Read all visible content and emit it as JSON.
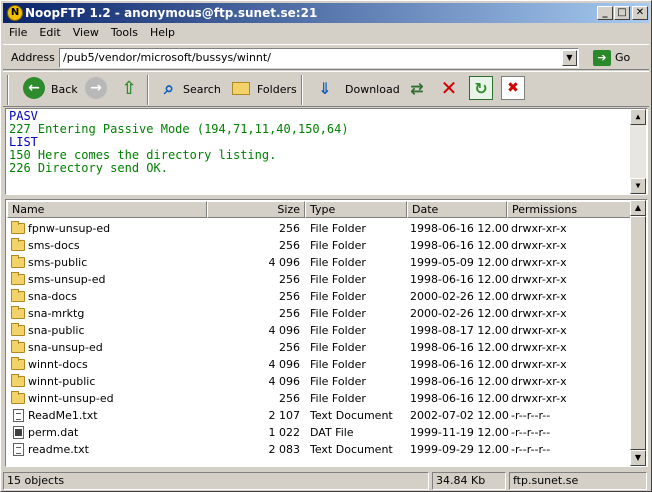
{
  "window": {
    "title": "NoopFTP 1.2 - anonymous@ftp.sunet.se:21",
    "app_icon": "N",
    "min": "_",
    "max": "□",
    "close": "✕"
  },
  "menu": [
    "File",
    "Edit",
    "View",
    "Tools",
    "Help"
  ],
  "address": {
    "label": "Address",
    "value": "/pub5/vendor/microsoft/bussys/winnt/",
    "go": "Go"
  },
  "toolbar": {
    "back": "Back",
    "search": "Search",
    "folders": "Folders",
    "download": "Download"
  },
  "log": [
    {
      "text": "PASV",
      "color": "#0000c0"
    },
    {
      "text": "227 Entering Passive Mode (194,71,11,40,150,64)",
      "color": "#008000"
    },
    {
      "text": "LIST",
      "color": "#0000c0"
    },
    {
      "text": "150 Here comes the directory listing.",
      "color": "#008000"
    },
    {
      "text": "226 Directory send OK.",
      "color": "#008000"
    }
  ],
  "columns": {
    "name": "Name",
    "size": "Size",
    "type": "Type",
    "date": "Date",
    "permissions": "Permissions"
  },
  "files": [
    {
      "icon": "folder",
      "name": "fpnw-unsup-ed",
      "size": "256",
      "type": "File Folder",
      "date": "1998-06-16 12.00",
      "perm": "drwxr-xr-x"
    },
    {
      "icon": "folder",
      "name": "sms-docs",
      "size": "256",
      "type": "File Folder",
      "date": "1998-06-16 12.00",
      "perm": "drwxr-xr-x"
    },
    {
      "icon": "folder",
      "name": "sms-public",
      "size": "4 096",
      "type": "File Folder",
      "date": "1999-05-09 12.00",
      "perm": "drwxr-xr-x"
    },
    {
      "icon": "folder",
      "name": "sms-unsup-ed",
      "size": "256",
      "type": "File Folder",
      "date": "1998-06-16 12.00",
      "perm": "drwxr-xr-x"
    },
    {
      "icon": "folder",
      "name": "sna-docs",
      "size": "256",
      "type": "File Folder",
      "date": "2000-02-26 12.00",
      "perm": "drwxr-xr-x"
    },
    {
      "icon": "folder",
      "name": "sna-mrktg",
      "size": "256",
      "type": "File Folder",
      "date": "2000-02-26 12.00",
      "perm": "drwxr-xr-x"
    },
    {
      "icon": "folder",
      "name": "sna-public",
      "size": "4 096",
      "type": "File Folder",
      "date": "1998-08-17 12.00",
      "perm": "drwxr-xr-x"
    },
    {
      "icon": "folder",
      "name": "sna-unsup-ed",
      "size": "256",
      "type": "File Folder",
      "date": "1998-06-16 12.00",
      "perm": "drwxr-xr-x"
    },
    {
      "icon": "folder",
      "name": "winnt-docs",
      "size": "4 096",
      "type": "File Folder",
      "date": "1998-06-16 12.00",
      "perm": "drwxr-xr-x"
    },
    {
      "icon": "folder",
      "name": "winnt-public",
      "size": "4 096",
      "type": "File Folder",
      "date": "1998-06-16 12.00",
      "perm": "drwxr-xr-x"
    },
    {
      "icon": "folder",
      "name": "winnt-unsup-ed",
      "size": "256",
      "type": "File Folder",
      "date": "1998-06-16 12.00",
      "perm": "drwxr-xr-x"
    },
    {
      "icon": "doc",
      "name": "ReadMe1.txt",
      "size": "2 107",
      "type": "Text Document",
      "date": "2002-07-02 12.00",
      "perm": "-r--r--r--"
    },
    {
      "icon": "dat",
      "name": "perm.dat",
      "size": "1 022",
      "type": "DAT File",
      "date": "1999-11-19 12.00",
      "perm": "-r--r--r--"
    },
    {
      "icon": "doc",
      "name": "readme.txt",
      "size": "2 083",
      "type": "Text Document",
      "date": "1999-09-29 12.00",
      "perm": "-r--r--r--"
    }
  ],
  "status": {
    "count": "15 objects",
    "size": "34.84 Kb",
    "host": "ftp.sunet.se"
  },
  "scroll": {
    "up": "▲",
    "down": "▼"
  }
}
